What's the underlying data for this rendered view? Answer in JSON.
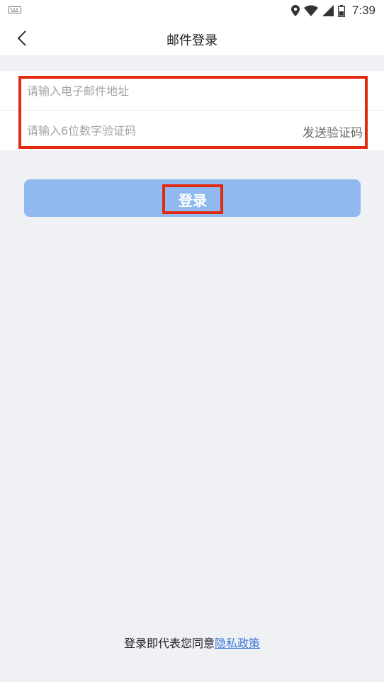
{
  "status_bar": {
    "time": "7:39",
    "icons": [
      "keyboard-icon",
      "location-icon",
      "wifi-icon",
      "signal-icon",
      "battery-icon"
    ]
  },
  "nav": {
    "title": "邮件登录",
    "back_icon": "back-arrow-icon"
  },
  "form": {
    "email_placeholder": "请输入电子邮件地址",
    "code_placeholder": "请输入6位数字验证码",
    "send_code_label": "发送验证码"
  },
  "login_button": {
    "label": "登录"
  },
  "footer": {
    "agreement_prefix": "登录即代表您同意",
    "privacy_link": "隐私政策"
  },
  "colors": {
    "background": "#f0f1f5",
    "button": "#8fb9ef",
    "highlight": "#e3290e",
    "link": "#3a78d8"
  }
}
